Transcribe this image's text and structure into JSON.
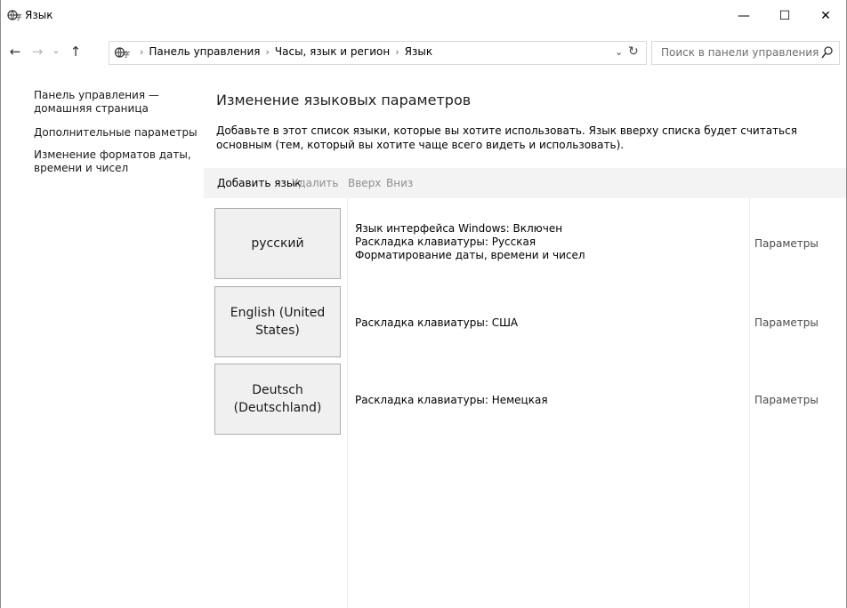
{
  "window": {
    "title": "Язык",
    "minimize": "—",
    "maximize": "☐",
    "close": "✕"
  },
  "nav": {
    "back": "←",
    "forward": "→",
    "recent": "⌄",
    "up": "↑"
  },
  "address": {
    "crumbs": [
      "Панель управления",
      "Часы, язык и регион",
      "Язык"
    ],
    "separator": "›",
    "dropdown": "⌄",
    "refresh": "↻"
  },
  "search": {
    "placeholder": "Поиск в панели управления"
  },
  "sidebar": {
    "home": "Панель управления — домашняя страница",
    "advanced": "Дополнительные параметры",
    "formats": "Изменение форматов даты, времени и чисел"
  },
  "main": {
    "title": "Изменение языковых параметров",
    "description": "Добавьте в этот список языки, которые вы хотите использовать. Язык вверху списка будет считаться основным (тем, который вы хотите чаще всего видеть и использовать)."
  },
  "toolbar": {
    "add": "Добавить язык",
    "remove": "Удалить",
    "up": "Вверх",
    "down": "Вниз"
  },
  "languages": [
    {
      "name": "русский",
      "info": [
        "Язык интерфейса Windows: Включен",
        "Раскладка клавиатуры: Русская",
        "Форматирование даты, времени и чисел"
      ],
      "options": "Параметры"
    },
    {
      "name": "English (United States)",
      "info": [
        "Раскладка клавиатуры: США"
      ],
      "options": "Параметры"
    },
    {
      "name": "Deutsch (Deutschland)",
      "info": [
        "Раскладка клавиатуры: Немецкая"
      ],
      "options": "Параметры"
    }
  ],
  "icons": {
    "title": "language-globe-icon",
    "address": "language-globe-icon",
    "search": "magnifier-icon"
  }
}
